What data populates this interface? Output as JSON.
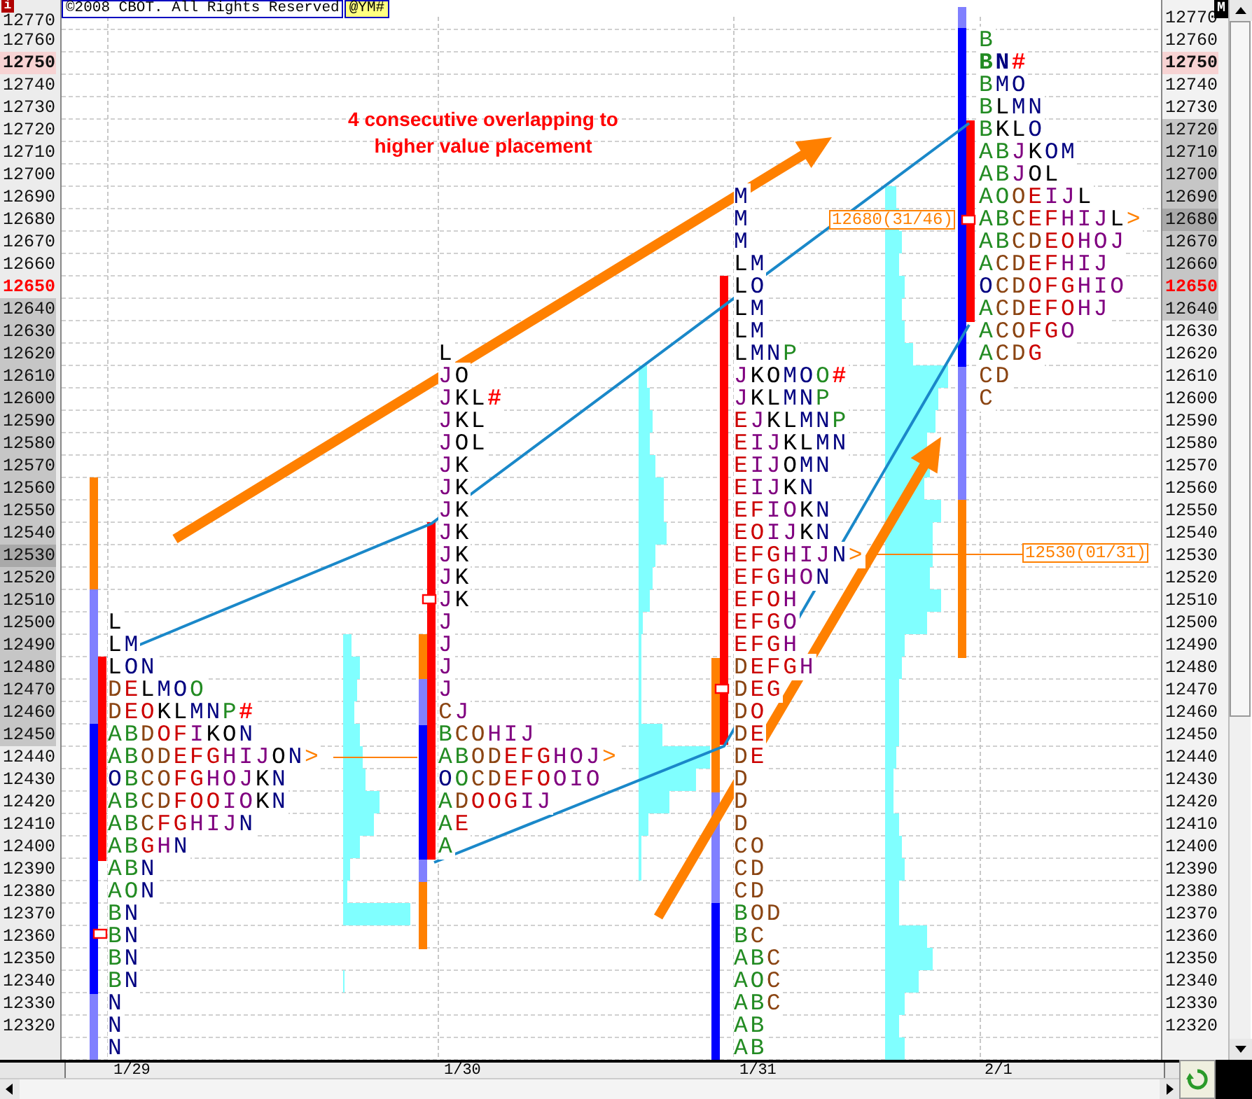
{
  "header": {
    "info_badge": "i",
    "copyright": "©2008 CBOT. All Rights Reserved",
    "symbol": "@YM#",
    "mode_badge": "M"
  },
  "left_axis": {
    "ticks": [
      {
        "label": "12770",
        "kind": "plain"
      },
      {
        "label": "12760",
        "kind": "plain"
      },
      {
        "label": "12750",
        "kind": "high"
      },
      {
        "label": "12740",
        "kind": "plain"
      },
      {
        "label": "12730",
        "kind": "plain"
      },
      {
        "label": "12720",
        "kind": "plain"
      },
      {
        "label": "12710",
        "kind": "plain"
      },
      {
        "label": "12700",
        "kind": "plain"
      },
      {
        "label": "12690",
        "kind": "plain"
      },
      {
        "label": "12680",
        "kind": "plain"
      },
      {
        "label": "12670",
        "kind": "plain"
      },
      {
        "label": "12660",
        "kind": "plain"
      },
      {
        "label": "12650",
        "kind": "last"
      },
      {
        "label": "12640",
        "kind": "area"
      },
      {
        "label": "12630",
        "kind": "area"
      },
      {
        "label": "12620",
        "kind": "area"
      },
      {
        "label": "12610",
        "kind": "area"
      },
      {
        "label": "12600",
        "kind": "area"
      },
      {
        "label": "12590",
        "kind": "area"
      },
      {
        "label": "12580",
        "kind": "area"
      },
      {
        "label": "12570",
        "kind": "area"
      },
      {
        "label": "12560",
        "kind": "area"
      },
      {
        "label": "12550",
        "kind": "area"
      },
      {
        "label": "12540",
        "kind": "area"
      },
      {
        "label": "12530",
        "kind": "poc"
      },
      {
        "label": "12520",
        "kind": "area"
      },
      {
        "label": "12510",
        "kind": "area"
      },
      {
        "label": "12500",
        "kind": "area"
      },
      {
        "label": "12490",
        "kind": "area"
      },
      {
        "label": "12480",
        "kind": "area"
      },
      {
        "label": "12470",
        "kind": "area"
      },
      {
        "label": "12460",
        "kind": "area"
      },
      {
        "label": "12450",
        "kind": "area"
      },
      {
        "label": "12440",
        "kind": "plain"
      },
      {
        "label": "12430",
        "kind": "plain"
      },
      {
        "label": "12420",
        "kind": "plain"
      },
      {
        "label": "12410",
        "kind": "plain"
      },
      {
        "label": "12400",
        "kind": "plain"
      },
      {
        "label": "12390",
        "kind": "plain"
      },
      {
        "label": "12380",
        "kind": "plain"
      },
      {
        "label": "12370",
        "kind": "plain"
      },
      {
        "label": "12360",
        "kind": "plain"
      },
      {
        "label": "12350",
        "kind": "plain"
      },
      {
        "label": "12340",
        "kind": "plain"
      },
      {
        "label": "12330",
        "kind": "plain"
      },
      {
        "label": "12320",
        "kind": "plain"
      }
    ]
  },
  "right_axis": {
    "ticks": [
      {
        "label": "12770",
        "kind": "plain"
      },
      {
        "label": "12760",
        "kind": "plain"
      },
      {
        "label": "12750",
        "kind": "high"
      },
      {
        "label": "12740",
        "kind": "plain"
      },
      {
        "label": "12730",
        "kind": "plain"
      },
      {
        "label": "12720",
        "kind": "area"
      },
      {
        "label": "12710",
        "kind": "area"
      },
      {
        "label": "12700",
        "kind": "area"
      },
      {
        "label": "12690",
        "kind": "area"
      },
      {
        "label": "12680",
        "kind": "poc"
      },
      {
        "label": "12670",
        "kind": "area"
      },
      {
        "label": "12660",
        "kind": "area"
      },
      {
        "label": "12650",
        "kind": "last-area"
      },
      {
        "label": "12640",
        "kind": "area"
      },
      {
        "label": "12630",
        "kind": "plain"
      },
      {
        "label": "12620",
        "kind": "plain"
      },
      {
        "label": "12610",
        "kind": "plain"
      },
      {
        "label": "12600",
        "kind": "plain"
      },
      {
        "label": "12590",
        "kind": "plain"
      },
      {
        "label": "12580",
        "kind": "plain"
      },
      {
        "label": "12570",
        "kind": "plain"
      },
      {
        "label": "12560",
        "kind": "plain"
      },
      {
        "label": "12550",
        "kind": "plain"
      },
      {
        "label": "12540",
        "kind": "plain"
      },
      {
        "label": "12530",
        "kind": "plain"
      },
      {
        "label": "12520",
        "kind": "plain"
      },
      {
        "label": "12510",
        "kind": "plain"
      },
      {
        "label": "12500",
        "kind": "plain"
      },
      {
        "label": "12490",
        "kind": "plain"
      },
      {
        "label": "12480",
        "kind": "plain"
      },
      {
        "label": "12470",
        "kind": "plain"
      },
      {
        "label": "12460",
        "kind": "plain"
      },
      {
        "label": "12450",
        "kind": "plain"
      },
      {
        "label": "12440",
        "kind": "plain"
      },
      {
        "label": "12430",
        "kind": "plain"
      },
      {
        "label": "12420",
        "kind": "plain"
      },
      {
        "label": "12410",
        "kind": "plain"
      },
      {
        "label": "12400",
        "kind": "plain"
      },
      {
        "label": "12390",
        "kind": "plain"
      },
      {
        "label": "12380",
        "kind": "plain"
      },
      {
        "label": "12370",
        "kind": "plain"
      },
      {
        "label": "12360",
        "kind": "plain"
      },
      {
        "label": "12350",
        "kind": "plain"
      },
      {
        "label": "12340",
        "kind": "plain"
      },
      {
        "label": "12330",
        "kind": "plain"
      },
      {
        "label": "12320",
        "kind": "plain"
      }
    ]
  },
  "annotation": "4 consecutive overlapping to\nhigher value placement",
  "price_tags": [
    {
      "text": "12680(31/46)"
    },
    {
      "text": "12530(01/31)"
    }
  ],
  "profiles": [
    {
      "date": "1/29",
      "rows": [
        {
          "letters": [
            {
              "text": "L",
              "color": "#000000"
            }
          ]
        },
        {
          "letters": [
            {
              "text": "L",
              "color": "#000000"
            },
            {
              "text": "M",
              "color": "#000080"
            }
          ]
        },
        {
          "letters": [
            {
              "text": "L",
              "color": "#000000"
            },
            {
              "text": "ON",
              "color": "#000080"
            }
          ]
        },
        {
          "letters": [
            {
              "text": "D",
              "color": "#8b4513"
            },
            {
              "text": "E",
              "color": "#cc0000"
            },
            {
              "text": "L",
              "color": "#000000"
            },
            {
              "text": "MO",
              "color": "#000080"
            },
            {
              "text": "O",
              "color": "#228b22"
            }
          ]
        },
        {
          "letters": [
            {
              "text": "D",
              "color": "#8b4513"
            },
            {
              "text": "EO",
              "color": "#cc0000"
            },
            {
              "text": "KL",
              "color": "#000000"
            },
            {
              "text": "MN",
              "color": "#000080"
            },
            {
              "text": "P",
              "color": "#228b22"
            },
            {
              "text": "#",
              "color": "#ff0000",
              "bold": true
            }
          ]
        },
        {
          "letters": [
            {
              "text": "AB",
              "color": "#228b22"
            },
            {
              "text": "D",
              "color": "#8b4513"
            },
            {
              "text": "OF",
              "color": "#cc0000"
            },
            {
              "text": "I",
              "color": "#800080"
            },
            {
              "text": "KO",
              "color": "#000000"
            },
            {
              "text": "N",
              "color": "#000080"
            }
          ]
        },
        {
          "letters": [
            {
              "text": "AB",
              "color": "#228b22"
            },
            {
              "text": "OD",
              "color": "#8b4513"
            },
            {
              "text": "EFG",
              "color": "#cc0000"
            },
            {
              "text": "HIJ",
              "color": "#800080"
            },
            {
              "text": "O",
              "color": "#000000"
            },
            {
              "text": "N",
              "color": "#000080"
            },
            {
              "text": ">",
              "color": "#ff8000"
            }
          ]
        },
        {
          "letters": [
            {
              "text": "O",
              "color": "#000080"
            },
            {
              "text": "B",
              "color": "#228b22"
            },
            {
              "text": "CO",
              "color": "#8b4513"
            },
            {
              "text": "FG",
              "color": "#cc0000"
            },
            {
              "text": "HOJ",
              "color": "#800080"
            },
            {
              "text": "K",
              "color": "#000000"
            },
            {
              "text": "N",
              "color": "#000080"
            }
          ]
        },
        {
          "letters": [
            {
              "text": "AB",
              "color": "#228b22"
            },
            {
              "text": "CD",
              "color": "#8b4513"
            },
            {
              "text": "FOO",
              "color": "#cc0000"
            },
            {
              "text": "IO",
              "color": "#800080"
            },
            {
              "text": "K",
              "color": "#000000"
            },
            {
              "text": "N",
              "color": "#000080"
            }
          ]
        },
        {
          "letters": [
            {
              "text": "AB",
              "color": "#228b22"
            },
            {
              "text": "C",
              "color": "#8b4513"
            },
            {
              "text": "FG",
              "color": "#cc0000"
            },
            {
              "text": "HIJ",
              "color": "#800080"
            },
            {
              "text": "N",
              "color": "#000080"
            }
          ]
        },
        {
          "letters": [
            {
              "text": "AB",
              "color": "#228b22"
            },
            {
              "text": "G",
              "color": "#cc0000"
            },
            {
              "text": "H",
              "color": "#800080"
            },
            {
              "text": "N",
              "color": "#000080"
            }
          ]
        },
        {
          "letters": [
            {
              "text": "AB",
              "color": "#228b22"
            },
            {
              "text": "N",
              "color": "#000080"
            }
          ]
        },
        {
          "letters": [
            {
              "text": "AO",
              "color": "#228b22"
            },
            {
              "text": "N",
              "color": "#000080"
            }
          ]
        },
        {
          "letters": [
            {
              "text": "B",
              "color": "#228b22"
            },
            {
              "text": "N",
              "color": "#000080"
            }
          ]
        },
        {
          "letters": [
            {
              "text": "B",
              "color": "#228b22"
            },
            {
              "text": "N",
              "color": "#000080"
            }
          ]
        },
        {
          "letters": [
            {
              "text": "B",
              "color": "#228b22"
            },
            {
              "text": "N",
              "color": "#000080"
            }
          ]
        },
        {
          "letters": [
            {
              "text": "B",
              "color": "#228b22"
            },
            {
              "text": "N",
              "color": "#000080"
            }
          ]
        },
        {
          "letters": [
            {
              "text": "N",
              "color": "#000080"
            }
          ]
        },
        {
          "letters": [
            {
              "text": "N",
              "color": "#000080"
            }
          ]
        },
        {
          "letters": [
            {
              "text": "N",
              "color": "#000080"
            }
          ]
        }
      ]
    },
    {
      "date": "1/30",
      "rows": [
        {
          "letters": [
            {
              "text": "L",
              "color": "#000000"
            }
          ]
        },
        {
          "letters": [
            {
              "text": "J",
              "color": "#800080"
            },
            {
              "text": "O",
              "color": "#000000"
            }
          ]
        },
        {
          "letters": [
            {
              "text": "J",
              "color": "#800080"
            },
            {
              "text": "KL",
              "color": "#000000"
            },
            {
              "text": "#",
              "color": "#ff0000",
              "bold": true
            }
          ]
        },
        {
          "letters": [
            {
              "text": "J",
              "color": "#800080"
            },
            {
              "text": "KL",
              "color": "#000000"
            }
          ]
        },
        {
          "letters": [
            {
              "text": "J",
              "color": "#800080"
            },
            {
              "text": "OL",
              "color": "#000000"
            }
          ]
        },
        {
          "letters": [
            {
              "text": "J",
              "color": "#800080"
            },
            {
              "text": "K",
              "color": "#000000"
            }
          ]
        },
        {
          "letters": [
            {
              "text": "J",
              "color": "#800080"
            },
            {
              "text": "K",
              "color": "#000000"
            }
          ]
        },
        {
          "letters": [
            {
              "text": "J",
              "color": "#800080"
            },
            {
              "text": "K",
              "color": "#000000"
            }
          ]
        },
        {
          "letters": [
            {
              "text": "J",
              "color": "#800080"
            },
            {
              "text": "K",
              "color": "#000000"
            }
          ]
        },
        {
          "letters": [
            {
              "text": "J",
              "color": "#800080"
            },
            {
              "text": "K",
              "color": "#000000"
            }
          ]
        },
        {
          "letters": [
            {
              "text": "J",
              "color": "#800080"
            },
            {
              "text": "K",
              "color": "#000000"
            }
          ]
        },
        {
          "letters": [
            {
              "text": "J",
              "color": "#800080"
            },
            {
              "text": "K",
              "color": "#000000"
            }
          ]
        },
        {
          "letters": [
            {
              "text": "J",
              "color": "#800080"
            }
          ]
        },
        {
          "letters": [
            {
              "text": "J",
              "color": "#800080"
            }
          ]
        },
        {
          "letters": [
            {
              "text": "J",
              "color": "#800080"
            }
          ]
        },
        {
          "letters": [
            {
              "text": "J",
              "color": "#800080"
            }
          ]
        },
        {
          "letters": [
            {
              "text": "C",
              "color": "#8b4513"
            },
            {
              "text": "J",
              "color": "#800080"
            }
          ]
        },
        {
          "letters": [
            {
              "text": "B",
              "color": "#228b22"
            },
            {
              "text": "CO",
              "color": "#8b4513"
            },
            {
              "text": "HIJ",
              "color": "#800080"
            }
          ]
        },
        {
          "letters": [
            {
              "text": "AB",
              "color": "#228b22"
            },
            {
              "text": "OD",
              "color": "#8b4513"
            },
            {
              "text": "EFG",
              "color": "#cc0000"
            },
            {
              "text": "HOJ",
              "color": "#800080"
            },
            {
              "text": ">",
              "color": "#ff8000"
            }
          ]
        },
        {
          "letters": [
            {
              "text": "O",
              "color": "#000080"
            },
            {
              "text": "O",
              "color": "#228b22"
            },
            {
              "text": "CD",
              "color": "#8b4513"
            },
            {
              "text": "EFO",
              "color": "#cc0000"
            },
            {
              "text": "OIO",
              "color": "#800080"
            }
          ]
        },
        {
          "letters": [
            {
              "text": "A",
              "color": "#228b22"
            },
            {
              "text": "D",
              "color": "#8b4513"
            },
            {
              "text": "OOG",
              "color": "#cc0000"
            },
            {
              "text": "IJ",
              "color": "#800080"
            }
          ]
        },
        {
          "letters": [
            {
              "text": "A",
              "color": "#228b22"
            },
            {
              "text": "E",
              "color": "#cc0000"
            }
          ]
        },
        {
          "letters": [
            {
              "text": "A",
              "color": "#228b22"
            }
          ]
        }
      ]
    },
    {
      "date": "1/31",
      "rows": [
        {
          "letters": [
            {
              "text": "M",
              "color": "#000080"
            }
          ]
        },
        {
          "letters": [
            {
              "text": "M",
              "color": "#000080"
            }
          ]
        },
        {
          "letters": [
            {
              "text": "M",
              "color": "#000080"
            }
          ]
        },
        {
          "letters": [
            {
              "text": "L",
              "color": "#000000"
            },
            {
              "text": "M",
              "color": "#000080"
            }
          ]
        },
        {
          "letters": [
            {
              "text": "L",
              "color": "#000000"
            },
            {
              "text": "O",
              "color": "#000080"
            }
          ]
        },
        {
          "letters": [
            {
              "text": "L",
              "color": "#000000"
            },
            {
              "text": "M",
              "color": "#000080"
            }
          ]
        },
        {
          "letters": [
            {
              "text": "L",
              "color": "#000000"
            },
            {
              "text": "M",
              "color": "#000080"
            }
          ]
        },
        {
          "letters": [
            {
              "text": "L",
              "color": "#000000"
            },
            {
              "text": "MN",
              "color": "#000080"
            },
            {
              "text": "P",
              "color": "#228b22"
            }
          ]
        },
        {
          "letters": [
            {
              "text": "J",
              "color": "#800080"
            },
            {
              "text": "KO",
              "color": "#000000"
            },
            {
              "text": "MO",
              "color": "#000080"
            },
            {
              "text": "O",
              "color": "#228b22"
            },
            {
              "text": "#",
              "color": "#ff0000",
              "bold": true
            }
          ]
        },
        {
          "letters": [
            {
              "text": "J",
              "color": "#800080"
            },
            {
              "text": "KL",
              "color": "#000000"
            },
            {
              "text": "MN",
              "color": "#000080"
            },
            {
              "text": "P",
              "color": "#228b22"
            }
          ]
        },
        {
          "letters": [
            {
              "text": "E",
              "color": "#cc0000"
            },
            {
              "text": "J",
              "color": "#800080"
            },
            {
              "text": "KL",
              "color": "#000000"
            },
            {
              "text": "MN",
              "color": "#000080"
            },
            {
              "text": "P",
              "color": "#228b22"
            }
          ]
        },
        {
          "letters": [
            {
              "text": "E",
              "color": "#cc0000"
            },
            {
              "text": "IJ",
              "color": "#800080"
            },
            {
              "text": "KL",
              "color": "#000000"
            },
            {
              "text": "MN",
              "color": "#000080"
            }
          ]
        },
        {
          "letters": [
            {
              "text": "E",
              "color": "#cc0000"
            },
            {
              "text": "IJ",
              "color": "#800080"
            },
            {
              "text": "O",
              "color": "#000000"
            },
            {
              "text": "MN",
              "color": "#000080"
            }
          ]
        },
        {
          "letters": [
            {
              "text": "E",
              "color": "#cc0000"
            },
            {
              "text": "IJ",
              "color": "#800080"
            },
            {
              "text": "K",
              "color": "#000000"
            },
            {
              "text": "N",
              "color": "#000080"
            }
          ]
        },
        {
          "letters": [
            {
              "text": "EF",
              "color": "#cc0000"
            },
            {
              "text": "IO",
              "color": "#800080"
            },
            {
              "text": "K",
              "color": "#000000"
            },
            {
              "text": "N",
              "color": "#000080"
            }
          ]
        },
        {
          "letters": [
            {
              "text": "EO",
              "color": "#cc0000"
            },
            {
              "text": "IJ",
              "color": "#800080"
            },
            {
              "text": "K",
              "color": "#000000"
            },
            {
              "text": "N",
              "color": "#000080"
            }
          ]
        },
        {
          "letters": [
            {
              "text": "EFG",
              "color": "#cc0000"
            },
            {
              "text": "HIJ",
              "color": "#800080"
            },
            {
              "text": "N",
              "color": "#000080"
            },
            {
              "text": ">",
              "color": "#ff8000"
            }
          ]
        },
        {
          "letters": [
            {
              "text": "EFG",
              "color": "#cc0000"
            },
            {
              "text": "HO",
              "color": "#800080"
            },
            {
              "text": "N",
              "color": "#000080"
            }
          ]
        },
        {
          "letters": [
            {
              "text": "EFO",
              "color": "#cc0000"
            },
            {
              "text": "H",
              "color": "#800080"
            }
          ]
        },
        {
          "letters": [
            {
              "text": "EFG",
              "color": "#cc0000"
            },
            {
              "text": "O",
              "color": "#800080"
            }
          ]
        },
        {
          "letters": [
            {
              "text": "EFG",
              "color": "#cc0000"
            },
            {
              "text": "H",
              "color": "#800080"
            }
          ]
        },
        {
          "letters": [
            {
              "text": "D",
              "color": "#8b4513"
            },
            {
              "text": "EFG",
              "color": "#cc0000"
            },
            {
              "text": "H",
              "color": "#800080"
            }
          ]
        },
        {
          "letters": [
            {
              "text": "D",
              "color": "#8b4513"
            },
            {
              "text": "EG",
              "color": "#cc0000"
            }
          ]
        },
        {
          "letters": [
            {
              "text": "D",
              "color": "#8b4513"
            },
            {
              "text": "O",
              "color": "#cc0000"
            }
          ]
        },
        {
          "letters": [
            {
              "text": "D",
              "color": "#8b4513"
            },
            {
              "text": "E",
              "color": "#cc0000"
            }
          ]
        },
        {
          "letters": [
            {
              "text": "D",
              "color": "#8b4513"
            },
            {
              "text": "E",
              "color": "#cc0000"
            }
          ]
        },
        {
          "letters": [
            {
              "text": "D",
              "color": "#8b4513"
            }
          ]
        },
        {
          "letters": [
            {
              "text": "D",
              "color": "#8b4513"
            }
          ]
        },
        {
          "letters": [
            {
              "text": "D",
              "color": "#8b4513"
            }
          ]
        },
        {
          "letters": [
            {
              "text": "CO",
              "color": "#8b4513"
            }
          ]
        },
        {
          "letters": [
            {
              "text": "CD",
              "color": "#8b4513"
            }
          ]
        },
        {
          "letters": [
            {
              "text": "CD",
              "color": "#8b4513"
            }
          ]
        },
        {
          "letters": [
            {
              "text": "B",
              "color": "#228b22"
            },
            {
              "text": "OD",
              "color": "#8b4513"
            }
          ]
        },
        {
          "letters": [
            {
              "text": "B",
              "color": "#228b22"
            },
            {
              "text": "C",
              "color": "#8b4513"
            }
          ]
        },
        {
          "letters": [
            {
              "text": "AB",
              "color": "#228b22"
            },
            {
              "text": "C",
              "color": "#8b4513"
            }
          ]
        },
        {
          "letters": [
            {
              "text": "AO",
              "color": "#228b22"
            },
            {
              "text": "C",
              "color": "#8b4513"
            }
          ]
        },
        {
          "letters": [
            {
              "text": "AB",
              "color": "#228b22"
            },
            {
              "text": "C",
              "color": "#8b4513"
            }
          ]
        },
        {
          "letters": [
            {
              "text": "AB",
              "color": "#228b22"
            }
          ]
        },
        {
          "letters": [
            {
              "text": "AB",
              "color": "#228b22"
            }
          ]
        }
      ]
    },
    {
      "date": "2/1",
      "rows": [
        {
          "letters": [
            {
              "text": "B",
              "color": "#228b22"
            }
          ]
        },
        {
          "letters": [
            {
              "text": "B",
              "color": "#228b22",
              "bold": true
            },
            {
              "text": "N",
              "color": "#000080",
              "bold": true
            },
            {
              "text": "#",
              "color": "#ff0000",
              "bold": true
            }
          ]
        },
        {
          "letters": [
            {
              "text": "B",
              "color": "#228b22"
            },
            {
              "text": "MO",
              "color": "#000080"
            }
          ]
        },
        {
          "letters": [
            {
              "text": "B",
              "color": "#228b22"
            },
            {
              "text": "L",
              "color": "#000000"
            },
            {
              "text": "MN",
              "color": "#000080"
            }
          ]
        },
        {
          "letters": [
            {
              "text": "B",
              "color": "#228b22"
            },
            {
              "text": "KL",
              "color": "#000000"
            },
            {
              "text": "O",
              "color": "#000080"
            }
          ]
        },
        {
          "letters": [
            {
              "text": "AB",
              "color": "#228b22"
            },
            {
              "text": "J",
              "color": "#800080"
            },
            {
              "text": "K",
              "color": "#000000"
            },
            {
              "text": "OM",
              "color": "#000080"
            }
          ]
        },
        {
          "letters": [
            {
              "text": "AB",
              "color": "#228b22"
            },
            {
              "text": "J",
              "color": "#800080"
            },
            {
              "text": "OL",
              "color": "#000000"
            }
          ]
        },
        {
          "letters": [
            {
              "text": "AO",
              "color": "#228b22"
            },
            {
              "text": "O",
              "color": "#8b4513"
            },
            {
              "text": "E",
              "color": "#cc0000"
            },
            {
              "text": "IJ",
              "color": "#800080"
            },
            {
              "text": "L",
              "color": "#000000"
            }
          ]
        },
        {
          "letters": [
            {
              "text": "AB",
              "color": "#228b22"
            },
            {
              "text": "C",
              "color": "#8b4513"
            },
            {
              "text": "EF",
              "color": "#cc0000"
            },
            {
              "text": "HIJ",
              "color": "#800080"
            },
            {
              "text": "L",
              "color": "#000000"
            },
            {
              "text": ">",
              "color": "#ff8000"
            }
          ]
        },
        {
          "letters": [
            {
              "text": "AB",
              "color": "#228b22"
            },
            {
              "text": "CD",
              "color": "#8b4513"
            },
            {
              "text": "EO",
              "color": "#cc0000"
            },
            {
              "text": "HOJ",
              "color": "#800080"
            }
          ]
        },
        {
          "letters": [
            {
              "text": "A",
              "color": "#228b22"
            },
            {
              "text": "CD",
              "color": "#8b4513"
            },
            {
              "text": "EF",
              "color": "#cc0000"
            },
            {
              "text": "HIJ",
              "color": "#800080"
            }
          ]
        },
        {
          "letters": [
            {
              "text": "O",
              "color": "#000080"
            },
            {
              "text": "CD",
              "color": "#8b4513"
            },
            {
              "text": "OFG",
              "color": "#cc0000"
            },
            {
              "text": "HIO",
              "color": "#800080"
            }
          ]
        },
        {
          "letters": [
            {
              "text": "A",
              "color": "#228b22"
            },
            {
              "text": "CD",
              "color": "#8b4513"
            },
            {
              "text": "EFO",
              "color": "#cc0000"
            },
            {
              "text": "HJ",
              "color": "#800080"
            }
          ]
        },
        {
          "letters": [
            {
              "text": "A",
              "color": "#228b22"
            },
            {
              "text": "CO",
              "color": "#8b4513"
            },
            {
              "text": "FG",
              "color": "#cc0000"
            },
            {
              "text": "O",
              "color": "#800080"
            }
          ]
        },
        {
          "letters": [
            {
              "text": "A",
              "color": "#228b22"
            },
            {
              "text": "CD",
              "color": "#8b4513"
            },
            {
              "text": "G",
              "color": "#cc0000"
            }
          ]
        },
        {
          "letters": [
            {
              "text": "CD",
              "color": "#8b4513"
            }
          ]
        },
        {
          "letters": [
            {
              "text": "C",
              "color": "#8b4513"
            }
          ]
        }
      ]
    }
  ]
}
